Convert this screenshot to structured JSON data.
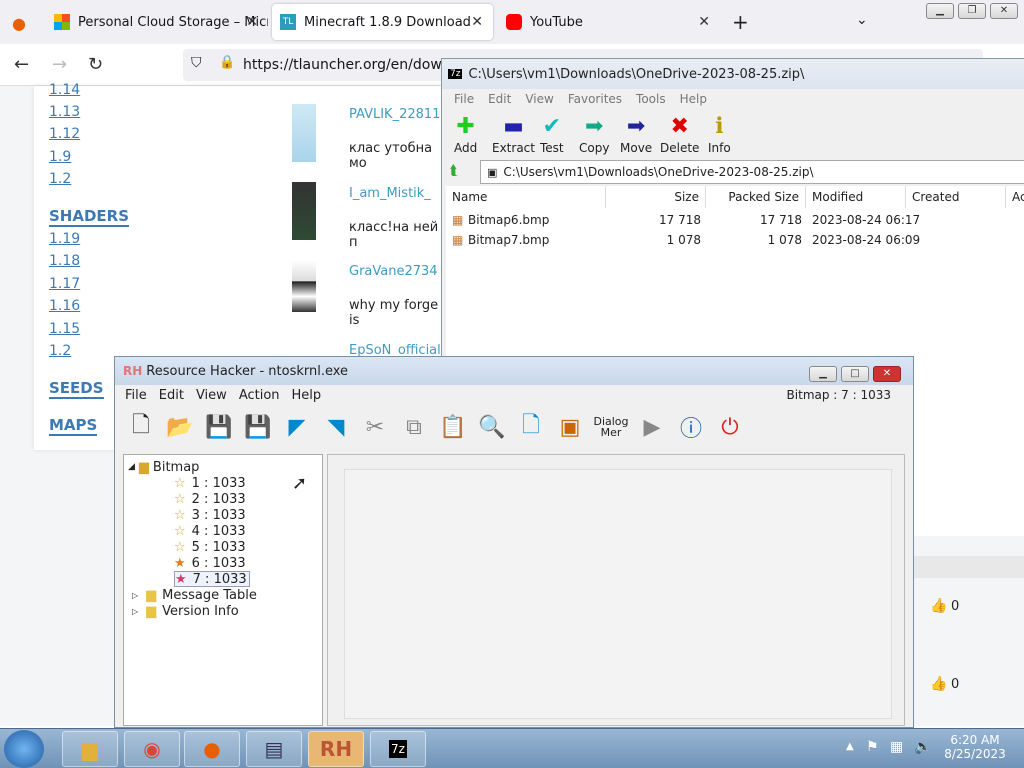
{
  "browser": {
    "tabs": [
      {
        "label": "Personal Cloud Storage – Micro"
      },
      {
        "label": "Minecraft 1.8.9 Download"
      },
      {
        "label": "YouTube"
      }
    ],
    "url": "https://tlauncher.org/en/downlo"
  },
  "page": {
    "versions_top": [
      "1.14",
      "1.13",
      "1.12",
      "1.9",
      "1.2"
    ],
    "shaders_heading": "SHADERS",
    "shader_versions": [
      "1.19",
      "1.18",
      "1.17",
      "1.16",
      "1.15",
      "1.2"
    ],
    "seeds": "SEEDS",
    "maps": "MAPS",
    "comments": [
      {
        "name": "PAVLIK_22811",
        "text": "клас утобна мо"
      },
      {
        "name": "I_am_Mistik_",
        "text": "класс!на ней п"
      },
      {
        "name": "GraVane2734",
        "text": "why my forge is"
      },
      {
        "name": "EpSoN_official",
        "text": ""
      }
    ],
    "likes": [
      "0",
      "0"
    ]
  },
  "sevenzip": {
    "title": "C:\\Users\\vm1\\Downloads\\OneDrive-2023-08-25.zip\\",
    "menu": [
      "File",
      "Edit",
      "View",
      "Favorites",
      "Tools",
      "Help"
    ],
    "toolbar": [
      "Add",
      "Extract",
      "Test",
      "Copy",
      "Move",
      "Delete",
      "Info"
    ],
    "address": "C:\\Users\\vm1\\Downloads\\OneDrive-2023-08-25.zip\\",
    "columns": [
      "Name",
      "Size",
      "Packed Size",
      "Modified",
      "Created",
      "Ac"
    ],
    "rows": [
      {
        "name": "Bitmap6.bmp",
        "size": "17 718",
        "packed": "17 718",
        "modified": "2023-08-24 06:17"
      },
      {
        "name": "Bitmap7.bmp",
        "size": "1 078",
        "packed": "1 078",
        "modified": "2023-08-24 06:09"
      }
    ]
  },
  "rh": {
    "title": "Resource Hacker - ntoskrnl.exe",
    "menu": [
      "File",
      "Edit",
      "View",
      "Action",
      "Help"
    ],
    "status": "Bitmap : 7 : 1033",
    "dialog_label": "Dialog",
    "dialog_label2": "Mer",
    "tree": {
      "root": "Bitmap",
      "items": [
        "1 : 1033",
        "2 : 1033",
        "3 : 1033",
        "4 : 1033",
        "5 : 1033",
        "6 : 1033",
        "7 : 1033"
      ],
      "others": [
        "Message Table",
        "Version Info"
      ]
    }
  },
  "clock": {
    "time": "6:20 AM",
    "date": "8/25/2023"
  },
  "colors": {
    "link": "#3d7ab3",
    "taskbar": "#7fa0c2"
  }
}
